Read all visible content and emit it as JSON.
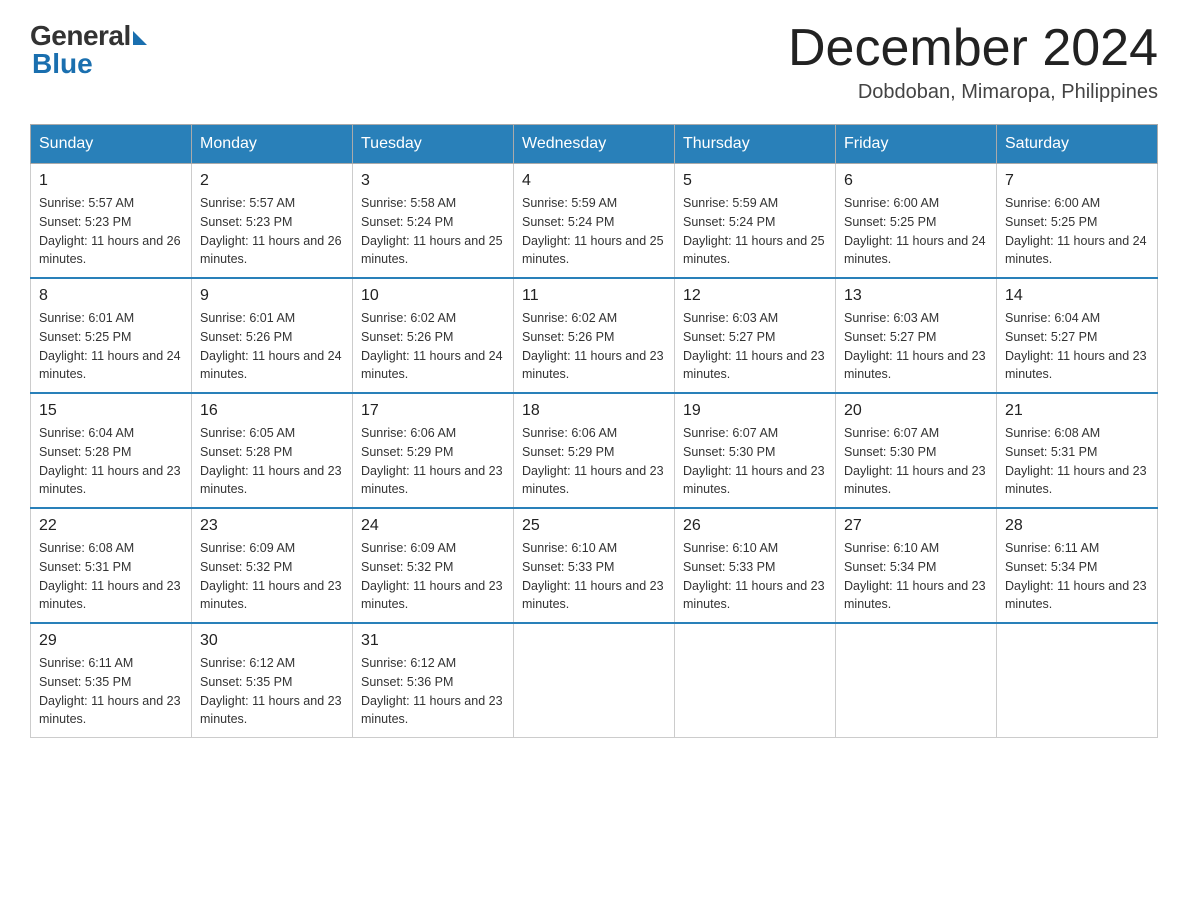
{
  "header": {
    "logo_general": "General",
    "logo_blue": "Blue",
    "month_title": "December 2024",
    "subtitle": "Dobdoban, Mimaropa, Philippines"
  },
  "days_of_week": [
    "Sunday",
    "Monday",
    "Tuesday",
    "Wednesday",
    "Thursday",
    "Friday",
    "Saturday"
  ],
  "weeks": [
    [
      {
        "day": "1",
        "sunrise": "Sunrise: 5:57 AM",
        "sunset": "Sunset: 5:23 PM",
        "daylight": "Daylight: 11 hours and 26 minutes."
      },
      {
        "day": "2",
        "sunrise": "Sunrise: 5:57 AM",
        "sunset": "Sunset: 5:23 PM",
        "daylight": "Daylight: 11 hours and 26 minutes."
      },
      {
        "day": "3",
        "sunrise": "Sunrise: 5:58 AM",
        "sunset": "Sunset: 5:24 PM",
        "daylight": "Daylight: 11 hours and 25 minutes."
      },
      {
        "day": "4",
        "sunrise": "Sunrise: 5:59 AM",
        "sunset": "Sunset: 5:24 PM",
        "daylight": "Daylight: 11 hours and 25 minutes."
      },
      {
        "day": "5",
        "sunrise": "Sunrise: 5:59 AM",
        "sunset": "Sunset: 5:24 PM",
        "daylight": "Daylight: 11 hours and 25 minutes."
      },
      {
        "day": "6",
        "sunrise": "Sunrise: 6:00 AM",
        "sunset": "Sunset: 5:25 PM",
        "daylight": "Daylight: 11 hours and 24 minutes."
      },
      {
        "day": "7",
        "sunrise": "Sunrise: 6:00 AM",
        "sunset": "Sunset: 5:25 PM",
        "daylight": "Daylight: 11 hours and 24 minutes."
      }
    ],
    [
      {
        "day": "8",
        "sunrise": "Sunrise: 6:01 AM",
        "sunset": "Sunset: 5:25 PM",
        "daylight": "Daylight: 11 hours and 24 minutes."
      },
      {
        "day": "9",
        "sunrise": "Sunrise: 6:01 AM",
        "sunset": "Sunset: 5:26 PM",
        "daylight": "Daylight: 11 hours and 24 minutes."
      },
      {
        "day": "10",
        "sunrise": "Sunrise: 6:02 AM",
        "sunset": "Sunset: 5:26 PM",
        "daylight": "Daylight: 11 hours and 24 minutes."
      },
      {
        "day": "11",
        "sunrise": "Sunrise: 6:02 AM",
        "sunset": "Sunset: 5:26 PM",
        "daylight": "Daylight: 11 hours and 23 minutes."
      },
      {
        "day": "12",
        "sunrise": "Sunrise: 6:03 AM",
        "sunset": "Sunset: 5:27 PM",
        "daylight": "Daylight: 11 hours and 23 minutes."
      },
      {
        "day": "13",
        "sunrise": "Sunrise: 6:03 AM",
        "sunset": "Sunset: 5:27 PM",
        "daylight": "Daylight: 11 hours and 23 minutes."
      },
      {
        "day": "14",
        "sunrise": "Sunrise: 6:04 AM",
        "sunset": "Sunset: 5:27 PM",
        "daylight": "Daylight: 11 hours and 23 minutes."
      }
    ],
    [
      {
        "day": "15",
        "sunrise": "Sunrise: 6:04 AM",
        "sunset": "Sunset: 5:28 PM",
        "daylight": "Daylight: 11 hours and 23 minutes."
      },
      {
        "day": "16",
        "sunrise": "Sunrise: 6:05 AM",
        "sunset": "Sunset: 5:28 PM",
        "daylight": "Daylight: 11 hours and 23 minutes."
      },
      {
        "day": "17",
        "sunrise": "Sunrise: 6:06 AM",
        "sunset": "Sunset: 5:29 PM",
        "daylight": "Daylight: 11 hours and 23 minutes."
      },
      {
        "day": "18",
        "sunrise": "Sunrise: 6:06 AM",
        "sunset": "Sunset: 5:29 PM",
        "daylight": "Daylight: 11 hours and 23 minutes."
      },
      {
        "day": "19",
        "sunrise": "Sunrise: 6:07 AM",
        "sunset": "Sunset: 5:30 PM",
        "daylight": "Daylight: 11 hours and 23 minutes."
      },
      {
        "day": "20",
        "sunrise": "Sunrise: 6:07 AM",
        "sunset": "Sunset: 5:30 PM",
        "daylight": "Daylight: 11 hours and 23 minutes."
      },
      {
        "day": "21",
        "sunrise": "Sunrise: 6:08 AM",
        "sunset": "Sunset: 5:31 PM",
        "daylight": "Daylight: 11 hours and 23 minutes."
      }
    ],
    [
      {
        "day": "22",
        "sunrise": "Sunrise: 6:08 AM",
        "sunset": "Sunset: 5:31 PM",
        "daylight": "Daylight: 11 hours and 23 minutes."
      },
      {
        "day": "23",
        "sunrise": "Sunrise: 6:09 AM",
        "sunset": "Sunset: 5:32 PM",
        "daylight": "Daylight: 11 hours and 23 minutes."
      },
      {
        "day": "24",
        "sunrise": "Sunrise: 6:09 AM",
        "sunset": "Sunset: 5:32 PM",
        "daylight": "Daylight: 11 hours and 23 minutes."
      },
      {
        "day": "25",
        "sunrise": "Sunrise: 6:10 AM",
        "sunset": "Sunset: 5:33 PM",
        "daylight": "Daylight: 11 hours and 23 minutes."
      },
      {
        "day": "26",
        "sunrise": "Sunrise: 6:10 AM",
        "sunset": "Sunset: 5:33 PM",
        "daylight": "Daylight: 11 hours and 23 minutes."
      },
      {
        "day": "27",
        "sunrise": "Sunrise: 6:10 AM",
        "sunset": "Sunset: 5:34 PM",
        "daylight": "Daylight: 11 hours and 23 minutes."
      },
      {
        "day": "28",
        "sunrise": "Sunrise: 6:11 AM",
        "sunset": "Sunset: 5:34 PM",
        "daylight": "Daylight: 11 hours and 23 minutes."
      }
    ],
    [
      {
        "day": "29",
        "sunrise": "Sunrise: 6:11 AM",
        "sunset": "Sunset: 5:35 PM",
        "daylight": "Daylight: 11 hours and 23 minutes."
      },
      {
        "day": "30",
        "sunrise": "Sunrise: 6:12 AM",
        "sunset": "Sunset: 5:35 PM",
        "daylight": "Daylight: 11 hours and 23 minutes."
      },
      {
        "day": "31",
        "sunrise": "Sunrise: 6:12 AM",
        "sunset": "Sunset: 5:36 PM",
        "daylight": "Daylight: 11 hours and 23 minutes."
      },
      {
        "day": "",
        "sunrise": "",
        "sunset": "",
        "daylight": ""
      },
      {
        "day": "",
        "sunrise": "",
        "sunset": "",
        "daylight": ""
      },
      {
        "day": "",
        "sunrise": "",
        "sunset": "",
        "daylight": ""
      },
      {
        "day": "",
        "sunrise": "",
        "sunset": "",
        "daylight": ""
      }
    ]
  ]
}
